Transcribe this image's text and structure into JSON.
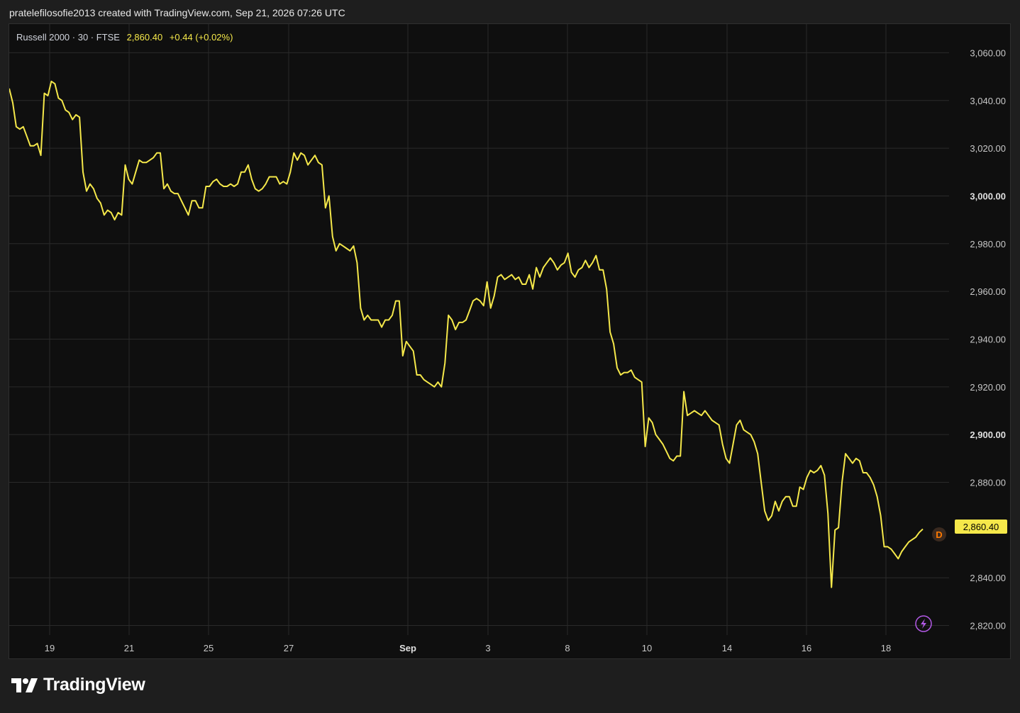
{
  "caption": "pratelefilosofie2013 created with TradingView.com, Sep 21, 2026 07:26 UTC",
  "legend": {
    "symbol": "Russell 2000 · 30 · FTSE",
    "last_price": "2,860.40",
    "change": "+0.44 (+0.02%)"
  },
  "price_tag": "2,860.40",
  "d_badge": "D",
  "brand": {
    "name": "TradingView",
    "icon": "tradingview-logo-icon"
  },
  "flash_icon": "lightning-icon",
  "colors": {
    "background": "#0f0f0f",
    "line": "#f5e84a",
    "grid": "#2a2a2a",
    "price_tag": "#f5e84a",
    "d_badge": "#ff7a00"
  },
  "chart_data": {
    "type": "line",
    "title": "",
    "ylim": [
      2816,
      3072
    ],
    "yticks": [
      3060,
      3040,
      3020,
      3000,
      2980,
      2960,
      2940,
      2920,
      2900,
      2880,
      2840,
      2820
    ],
    "yticks_labels": [
      "3,060.00",
      "3,040.00",
      "3,020.00",
      "3,000.00",
      "2,980.00",
      "2,960.00",
      "2,940.00",
      "2,920.00",
      "2,900.00",
      "2,880.00",
      "2,840.00",
      "2,820.00"
    ],
    "yticks_bold": [
      "3,000.00",
      "2,900.00"
    ],
    "x_tick_labels": [
      "19",
      "21",
      "25",
      "27",
      "Sep",
      "3",
      "8",
      "10",
      "14",
      "16",
      "18"
    ],
    "x_tick_bold": [
      "Sep"
    ],
    "series": [
      {
        "values": [
          3045,
          3039,
          3029,
          3028,
          3029,
          3025,
          3021,
          3021,
          3022,
          3017,
          3043,
          3042,
          3048,
          3047,
          3041,
          3040,
          3036,
          3035,
          3032,
          3034,
          3033,
          3010,
          3002,
          3005,
          3003,
          2999,
          2997,
          2992,
          2994,
          2993,
          2990,
          2993,
          2992,
          3013,
          3007,
          3005,
          3010,
          3015,
          3014,
          3014,
          3015,
          3016,
          3018,
          3018,
          3003,
          3005,
          3002,
          3001,
          3001,
          2998,
          2995,
          2992,
          2998,
          2998,
          2995,
          2995,
          3004,
          3004,
          3006,
          3007,
          3005,
          3004,
          3004,
          3005,
          3004,
          3005,
          3010,
          3010,
          3013,
          3007,
          3003,
          3002,
          3003,
          3005,
          3008,
          3008,
          3008,
          3005,
          3006,
          3005,
          3010,
          3018,
          3015,
          3018,
          3017,
          3013,
          3015,
          3017,
          3014,
          3013,
          2995,
          3000,
          2983,
          2977,
          2980,
          2979,
          2978,
          2977,
          2979,
          2972,
          2953,
          2948,
          2950,
          2948,
          2948,
          2948,
          2945,
          2948,
          2948,
          2950,
          2956,
          2956,
          2933,
          2939,
          2937,
          2935,
          2925,
          2925,
          2923,
          2922,
          2921,
          2920,
          2922,
          2920,
          2930,
          2950,
          2948,
          2944,
          2947,
          2947,
          2948,
          2952,
          2956,
          2957,
          2956,
          2954,
          2964,
          2953,
          2958,
          2966,
          2967,
          2965,
          2966,
          2967,
          2965,
          2966,
          2963,
          2963,
          2967,
          2961,
          2970,
          2966,
          2970,
          2972,
          2974,
          2972,
          2969,
          2971,
          2972,
          2976,
          2968,
          2966,
          2969,
          2970,
          2973,
          2970,
          2972,
          2975,
          2969,
          2969,
          2961,
          2943,
          2938,
          2928,
          2925,
          2926,
          2926,
          2927,
          2924,
          2923,
          2922,
          2895,
          2907,
          2905,
          2900,
          2898,
          2896,
          2893,
          2890,
          2889,
          2891,
          2891,
          2918,
          2908,
          2909,
          2910,
          2909,
          2908,
          2910,
          2908,
          2906,
          2905,
          2904,
          2896,
          2890,
          2888,
          2896,
          2904,
          2906,
          2902,
          2901,
          2900,
          2897,
          2892,
          2880,
          2868,
          2864,
          2866,
          2872,
          2868,
          2872,
          2874,
          2874,
          2870,
          2870,
          2878,
          2877,
          2882,
          2885,
          2884,
          2885,
          2887,
          2883,
          2867,
          2836,
          2860,
          2861,
          2880,
          2892,
          2890,
          2888,
          2890,
          2889,
          2884,
          2884,
          2882,
          2879,
          2874,
          2866,
          2853,
          2853,
          2852,
          2850,
          2848,
          2851,
          2853,
          2855,
          2856,
          2857,
          2859,
          2860.4
        ]
      }
    ]
  }
}
